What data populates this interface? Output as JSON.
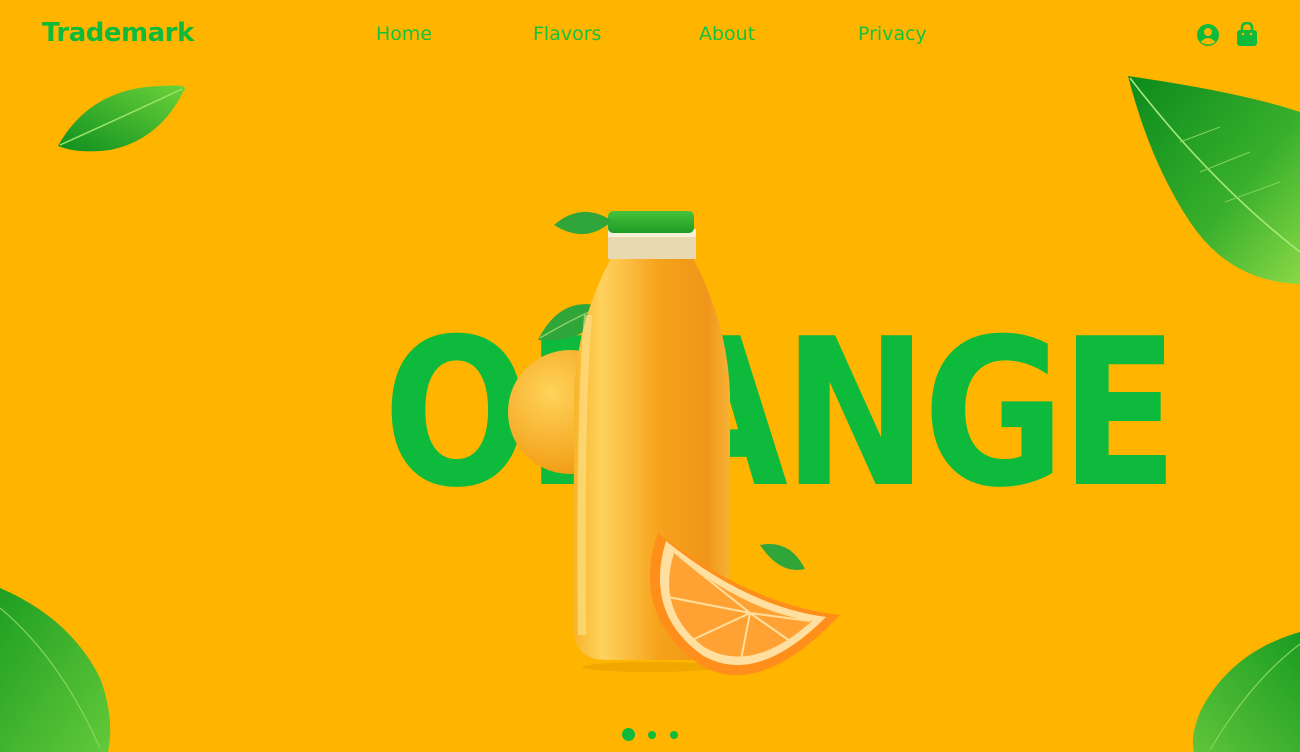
{
  "brand": {
    "logo": "Trademark"
  },
  "nav": {
    "items": [
      {
        "label": "Home"
      },
      {
        "label": "Flavors"
      },
      {
        "label": "About"
      },
      {
        "label": "Privacy"
      }
    ]
  },
  "header_icons": {
    "account": "user-circle-icon",
    "cart": "shopping-bag-icon"
  },
  "hero": {
    "word": "ORANGE"
  },
  "slider": {
    "count": 3,
    "active_index": 0
  },
  "colors": {
    "background": "#FFB500",
    "accent_green": "#0DBA3B",
    "nav_text": "#13C23E"
  }
}
